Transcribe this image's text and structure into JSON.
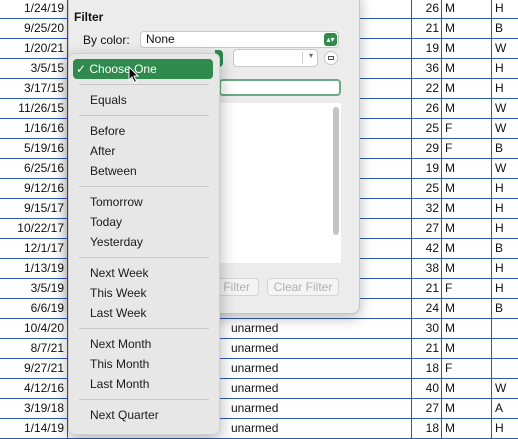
{
  "rows": [
    {
      "date": "1/24/19",
      "weapon": "",
      "age": "26",
      "sex": "M",
      "race": "H"
    },
    {
      "date": "9/25/20",
      "weapon": "",
      "age": "21",
      "sex": "M",
      "race": "B"
    },
    {
      "date": "1/20/21",
      "weapon": "",
      "age": "19",
      "sex": "M",
      "race": "W"
    },
    {
      "date": "3/5/15",
      "weapon": "",
      "age": "36",
      "sex": "M",
      "race": "H"
    },
    {
      "date": "3/17/15",
      "weapon": "",
      "age": "22",
      "sex": "M",
      "race": "H"
    },
    {
      "date": "11/26/15",
      "weapon": "",
      "age": "26",
      "sex": "M",
      "race": "W"
    },
    {
      "date": "1/16/16",
      "weapon": "",
      "age": "25",
      "sex": "F",
      "race": "W"
    },
    {
      "date": "5/19/16",
      "weapon": "",
      "age": "29",
      "sex": "F",
      "race": "B"
    },
    {
      "date": "6/25/16",
      "weapon": "",
      "age": "19",
      "sex": "M",
      "race": "W"
    },
    {
      "date": "9/12/16",
      "weapon": "",
      "age": "25",
      "sex": "M",
      "race": "H"
    },
    {
      "date": "9/15/17",
      "weapon": "",
      "age": "32",
      "sex": "M",
      "race": "H"
    },
    {
      "date": "10/22/17",
      "weapon": "",
      "age": "27",
      "sex": "M",
      "race": "H"
    },
    {
      "date": "12/1/17",
      "weapon": "",
      "age": "42",
      "sex": "M",
      "race": "B"
    },
    {
      "date": "1/13/19",
      "weapon": "",
      "age": "38",
      "sex": "M",
      "race": "H"
    },
    {
      "date": "3/5/19",
      "weapon": "",
      "age": "21",
      "sex": "F",
      "race": "H"
    },
    {
      "date": "6/6/19",
      "weapon": "",
      "age": "24",
      "sex": "M",
      "race": "B"
    },
    {
      "date": "10/4/20",
      "weapon": "unarmed",
      "age": "30",
      "sex": "M",
      "race": ""
    },
    {
      "date": "8/7/21",
      "weapon": "unarmed",
      "age": "21",
      "sex": "M",
      "race": ""
    },
    {
      "date": "9/27/21",
      "weapon": "unarmed",
      "age": "18",
      "sex": "F",
      "race": ""
    },
    {
      "date": "4/12/16",
      "weapon": "unarmed",
      "age": "40",
      "sex": "M",
      "race": "W"
    },
    {
      "date": "3/19/18",
      "weapon": "unarmed",
      "age": "27",
      "sex": "M",
      "race": "A"
    },
    {
      "date": "1/14/19",
      "weapon": "unarmed",
      "age": "18",
      "sex": "M",
      "race": "H"
    }
  ],
  "filter": {
    "title": "Filter",
    "by_color_label": "By color:",
    "by_color_value": "None",
    "apply_label": "Apply Filter",
    "apply_visible": "y Filter",
    "clear_label": "Clear Filter"
  },
  "menu": {
    "selected": "✓ Choose One",
    "items": [
      "Equals",
      "Before",
      "After",
      "Between",
      "Tomorrow",
      "Today",
      "Yesterday",
      "Next Week",
      "This Week",
      "Last Week",
      "Next Month",
      "This Month",
      "Last Month",
      "Next Quarter"
    ]
  },
  "colors": {
    "accent": "#2f8a4e",
    "gridline": "#2e58b8"
  }
}
